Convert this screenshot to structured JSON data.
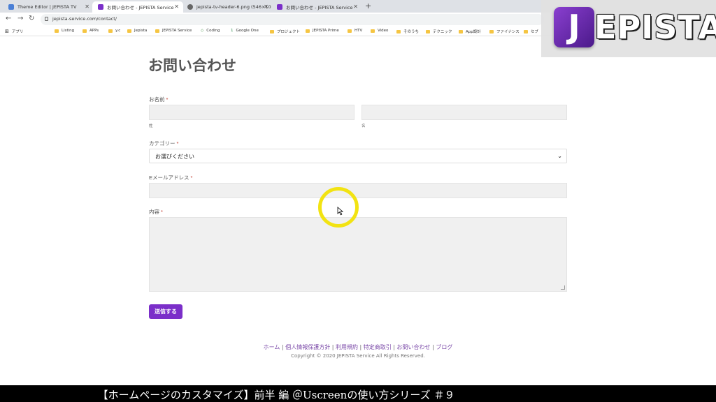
{
  "browser": {
    "tabs": [
      {
        "label": "Theme Editor | JEPISTA TV",
        "favicon_color": "#4a7fd6"
      },
      {
        "label": "お問い合わせ - JEPISTA Service",
        "favicon_color": "#7b2fc9"
      },
      {
        "label": "jepista-tv-header-6.png (546×10",
        "favicon_color": "#666666"
      },
      {
        "label": "お問い合わせ - JEPISTA Service",
        "favicon_color": "#7b2fc9"
      }
    ],
    "url": "jepista-service.com/contact/",
    "bookmarks": [
      "アプリ",
      "Listing",
      "APPs",
      "y.c",
      "Jepista",
      "JEPISTA Service",
      "Coding",
      "Google One",
      "プロジェクト",
      "JEPISTA Prime",
      "HTV",
      "Video",
      "そのうち",
      "テクニック",
      "App設計",
      "ファイナンス",
      "セブ"
    ]
  },
  "overlay": {
    "logo_j": "J",
    "logo_text": "EPISTA"
  },
  "form": {
    "title": "お問い合わせ",
    "name_label": "お名前",
    "last_name_sublabel": "姓",
    "first_name_sublabel": "名",
    "category_label": "カテゴリー",
    "category_selected": "お選びください",
    "email_label": "Eメールアドレス",
    "content_label": "内容",
    "required_mark": "*",
    "submit_label": "送信する"
  },
  "footer": {
    "links": [
      "ホーム",
      "個人情報保護方針",
      "利用規約",
      "特定商取引",
      "お問い合わせ",
      "ブログ"
    ],
    "copyright": "Copyright © 2020 JEPISTA Service All Rights Reserved."
  },
  "caption": "【ホームページのカスタマイズ】前半 編 ＠Uscreenの使い方シリーズ ＃９",
  "colors": {
    "accent": "#7b2fc9",
    "highlight_ring": "#f2e312",
    "required": "#c0392b"
  }
}
